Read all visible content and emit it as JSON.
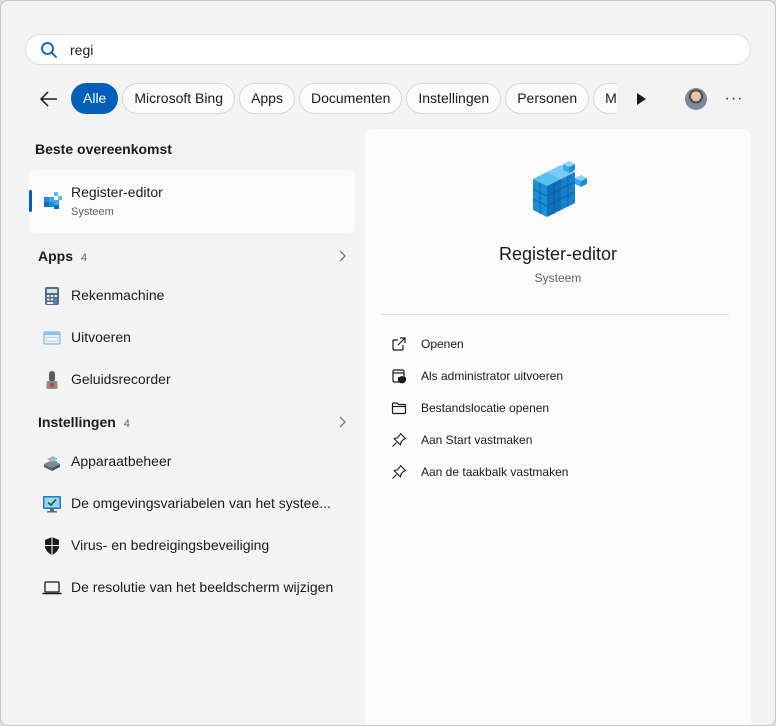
{
  "search": {
    "value": "regi",
    "icon": "search-icon"
  },
  "nav": {
    "back_icon": "arrow-left-icon",
    "more_label": "···"
  },
  "chips": [
    {
      "label": "Alle",
      "active": true
    },
    {
      "label": "Microsoft Bing"
    },
    {
      "label": "Apps"
    },
    {
      "label": "Documenten"
    },
    {
      "label": "Instellingen"
    },
    {
      "label": "Personen"
    },
    {
      "label": "M"
    }
  ],
  "best_match": {
    "heading": "Beste overeenkomst",
    "title": "Register-editor",
    "subtitle": "Systeem",
    "icon": "registry-editor-icon"
  },
  "apps": {
    "heading": "Apps",
    "count": "4",
    "items": [
      {
        "label": "Rekenmachine",
        "icon": "calculator-icon"
      },
      {
        "label": "Uitvoeren",
        "icon": "run-icon"
      },
      {
        "label": "Geluidsrecorder",
        "icon": "microphone-icon"
      }
    ]
  },
  "settings": {
    "heading": "Instellingen",
    "count": "4",
    "items": [
      {
        "label": "Apparaatbeheer",
        "icon": "device-manager-icon"
      },
      {
        "label": "De omgevingsvariabelen van het systee...",
        "icon": "monitor-check-icon"
      },
      {
        "label": "Virus- en bedreigingsbeveiliging",
        "icon": "shield-icon"
      },
      {
        "label": "De resolutie van het beeldscherm wijzigen",
        "icon": "laptop-icon"
      }
    ]
  },
  "detail": {
    "title": "Register-editor",
    "subtitle": "Systeem",
    "actions": [
      {
        "label": "Openen",
        "icon": "open-external-icon"
      },
      {
        "label": "Als administrator uitvoeren",
        "icon": "admin-shield-icon"
      },
      {
        "label": "Bestandslocatie openen",
        "icon": "folder-icon"
      },
      {
        "label": "Aan Start vastmaken",
        "icon": "pin-icon"
      },
      {
        "label": "Aan de taakbalk vastmaken",
        "icon": "pin-icon"
      }
    ]
  },
  "colors": {
    "accent": "#005fb8",
    "background": "#f3f3f3",
    "panel": "#fbfbfb"
  }
}
